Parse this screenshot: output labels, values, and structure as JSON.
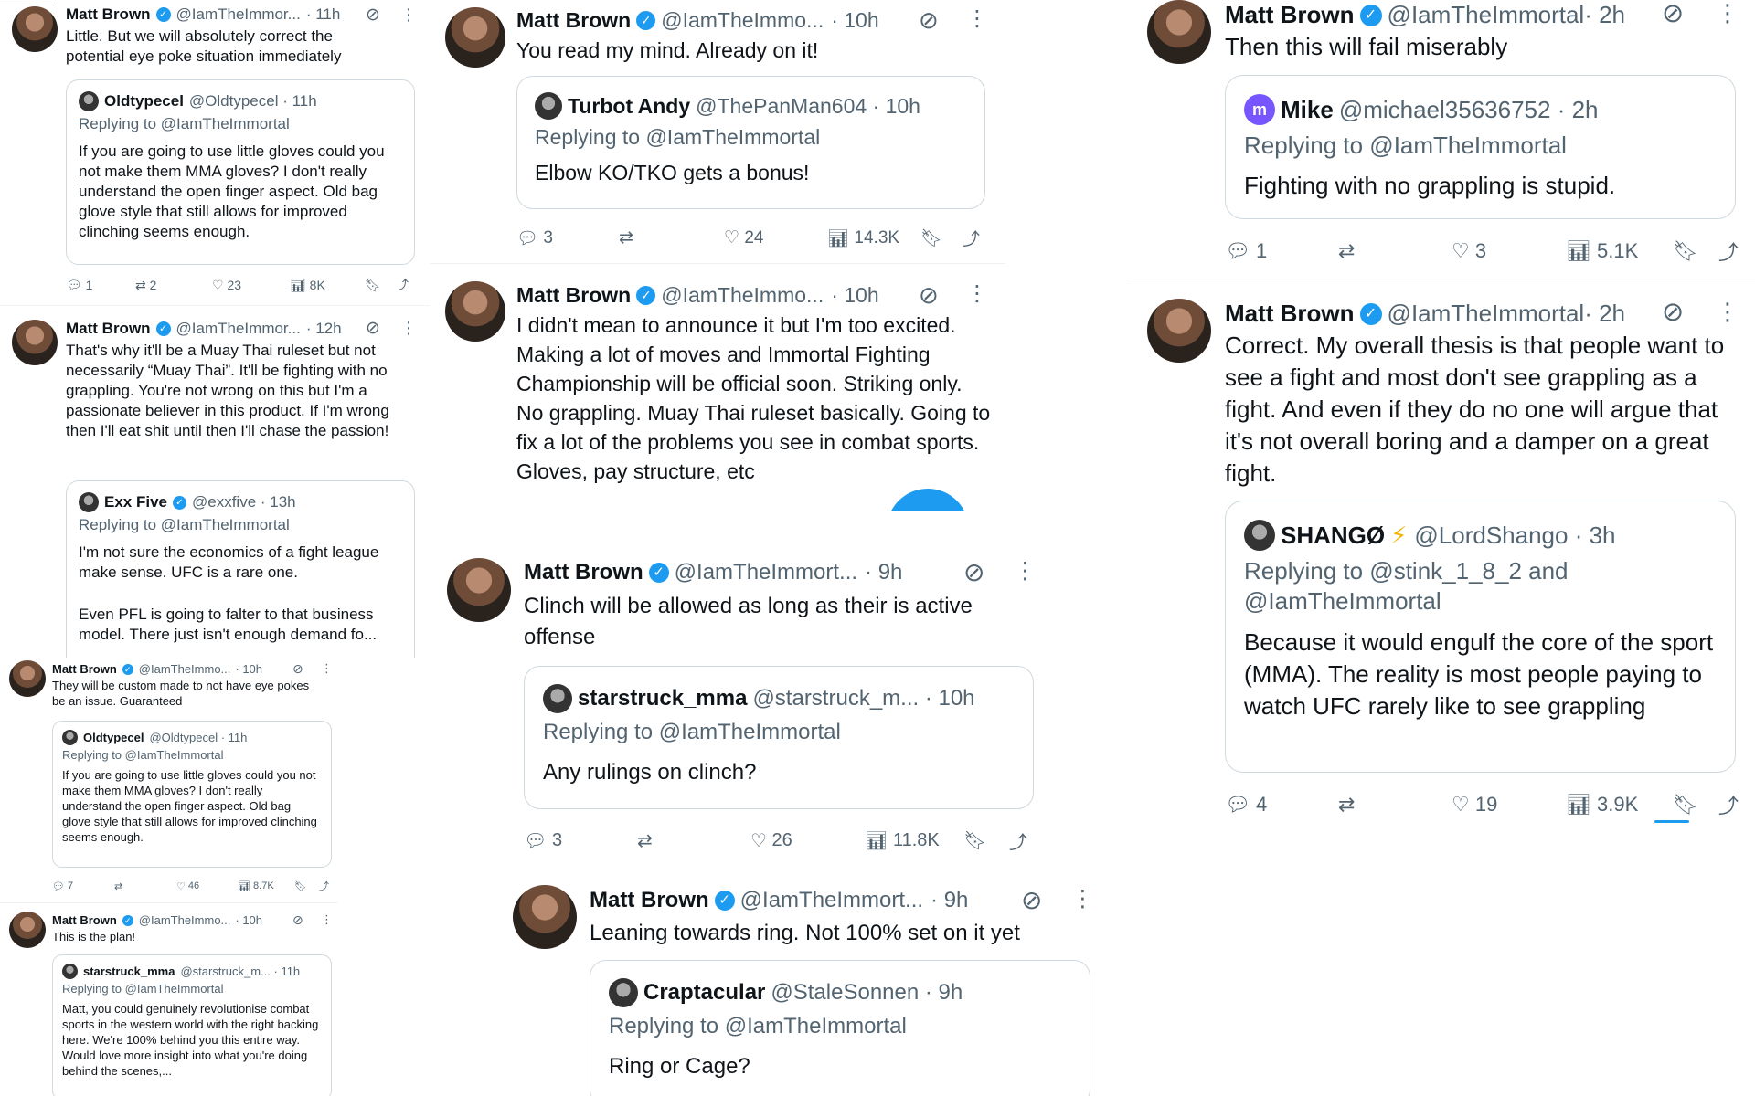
{
  "author": {
    "name": "Matt Brown",
    "handle_short1": "@IamTheImmor...",
    "handle_short2": "@IamTheImmo...",
    "handle_short3": "@IamTheImmort...",
    "handle_full": "@IamTheImmortal"
  },
  "icons": {
    "verified": "verified-badge-icon",
    "grok": "grok-icon",
    "more": "more-icon",
    "reply": "reply-icon",
    "retweet": "retweet-icon",
    "like": "like-icon",
    "views": "views-icon",
    "bookmark": "bookmark-icon",
    "share": "share-icon"
  },
  "t1": {
    "time": "· 11h",
    "text": "Little. But we will absolutely correct the potential eye poke situation immediately",
    "q": {
      "name": "Oldtypecel",
      "handle": "@Oldtypecel · 11h",
      "reply": "Replying to @IamTheImmortal",
      "text": "If you are going to use little gloves could you not make them MMA gloves? I don't really understand the open finger aspect. Old bag glove style that still allows for improved clinching seems enough."
    },
    "stats": {
      "replies": "1",
      "retweets": "2",
      "likes": "23",
      "views": "8K"
    }
  },
  "t2": {
    "time": "· 12h",
    "text": "That's why it'll be a Muay Thai ruleset but not necessarily “Muay Thai”. It'll be fighting with no grappling. You're not wrong on this but I'm a passionate believer in this product. If I'm wrong then I'll eat shit until then I'll chase the passion!",
    "q": {
      "name": "Exx Five",
      "handle": "@exxfive · 13h",
      "reply": "Replying to @IamTheImmortal",
      "text1": "I'm not sure the economics of a fight league make sense. UFC is a rare one.",
      "text2": "Even PFL is going to falter to that business model. There just isn't enough demand fo..."
    }
  },
  "t3": {
    "time": "· 10h",
    "text": "They will be custom made to not have eye pokes be an issue. Guaranteed",
    "q": {
      "name": "Oldtypecel",
      "handle": "@Oldtypecel · 11h",
      "reply": "Replying to @IamTheImmortal",
      "text": "If you are going to use little gloves could you not make them MMA gloves? I don't really understand the open finger aspect. Old bag glove style that still allows for improved clinching seems enough."
    },
    "stats": {
      "replies": "7",
      "retweets": "",
      "likes": "46",
      "views": "8.7K"
    }
  },
  "t4": {
    "time": "· 10h",
    "text": "This is the plan!",
    "q": {
      "name": "starstruck_mma",
      "handle": "@starstruck_m... · 11h",
      "reply": "Replying to @IamTheImmortal",
      "text": "Matt, you could genuinely revolutionise combat sports in the western world with the right backing here. We're 100% behind you this entire way. Would love more insight into what you're doing behind the scenes,..."
    }
  },
  "t5": {
    "time": "· 10h",
    "text": "You read my mind. Already on it!",
    "q": {
      "name": "Turbot Andy",
      "handle": "@ThePanMan604 · 10h",
      "reply": "Replying to @IamTheImmortal",
      "text": "Elbow KO/TKO gets a bonus!"
    },
    "stats": {
      "replies": "3",
      "retweets": "",
      "likes": "24",
      "views": "14.3K"
    }
  },
  "t6": {
    "time": "· 10h",
    "text": "I didn't mean to announce it but I'm too excited. Making a lot of moves and Immortal Fighting Championship will be official soon. Striking only. No grappling. Muay Thai ruleset basically. Going to fix a lot of the problems you see in combat sports. Gloves, pay structure, etc"
  },
  "t7": {
    "time": "· 9h",
    "text": "Clinch will be allowed as long as their is active offense",
    "q": {
      "name": "starstruck_mma",
      "handle": "@starstruck_m... · 10h",
      "reply": "Replying to @IamTheImmortal",
      "text": "Any rulings on clinch?"
    },
    "stats": {
      "replies": "3",
      "retweets": "",
      "likes": "26",
      "views": "11.8K"
    }
  },
  "t8": {
    "time": "· 9h",
    "text": "Leaning towards ring. Not 100% set on it yet",
    "q": {
      "name": "Craptacular",
      "handle": "@StaleSonnen · 9h",
      "reply": "Replying to @IamTheImmortal",
      "text": "Ring or Cage?"
    }
  },
  "t9": {
    "time": "· 2h",
    "text": "Then this will fail miserably",
    "q": {
      "avatar_letter": "m",
      "name": "Mike",
      "handle": "@michael35636752 · 2h",
      "reply": "Replying to @IamTheImmortal",
      "text": "Fighting with no grappling is stupid."
    },
    "stats": {
      "replies": "1",
      "retweets": "",
      "likes": "3",
      "views": "5.1K"
    }
  },
  "t10": {
    "time": "· 2h",
    "text": "Correct. My overall thesis is that people want to see a fight and most don't see grappling as a fight. And even if they do no one will argue that it's not overall boring and a damper on a great fight.",
    "q": {
      "name": "SHANGØ",
      "emoji": "⚡",
      "handle": "@LordShango · 3h",
      "reply1": "Replying to @stink_1_8_2 and",
      "reply2": "@IamTheImmortal",
      "text": "Because it would engulf the core of the sport (MMA). The reality is most people paying to watch UFC rarely like to see grappling"
    },
    "stats": {
      "replies": "4",
      "retweets": "",
      "likes": "19",
      "views": "3.9K"
    }
  }
}
